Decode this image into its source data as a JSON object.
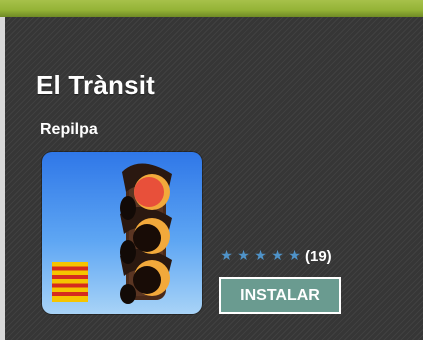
{
  "app": {
    "title": "El Trànsit",
    "author": "Repilpa",
    "icon": "traffic-light-icon"
  },
  "rating": {
    "stars": 5,
    "max_stars": 5,
    "count": "(19)",
    "star_icon": "star-icon"
  },
  "actions": {
    "install_label": "INSTALAR"
  },
  "colors": {
    "top_bar": "#94b336",
    "panel_background": "#3b3b3b",
    "star": "#4f93c9",
    "install_button": "#6a9b90"
  }
}
